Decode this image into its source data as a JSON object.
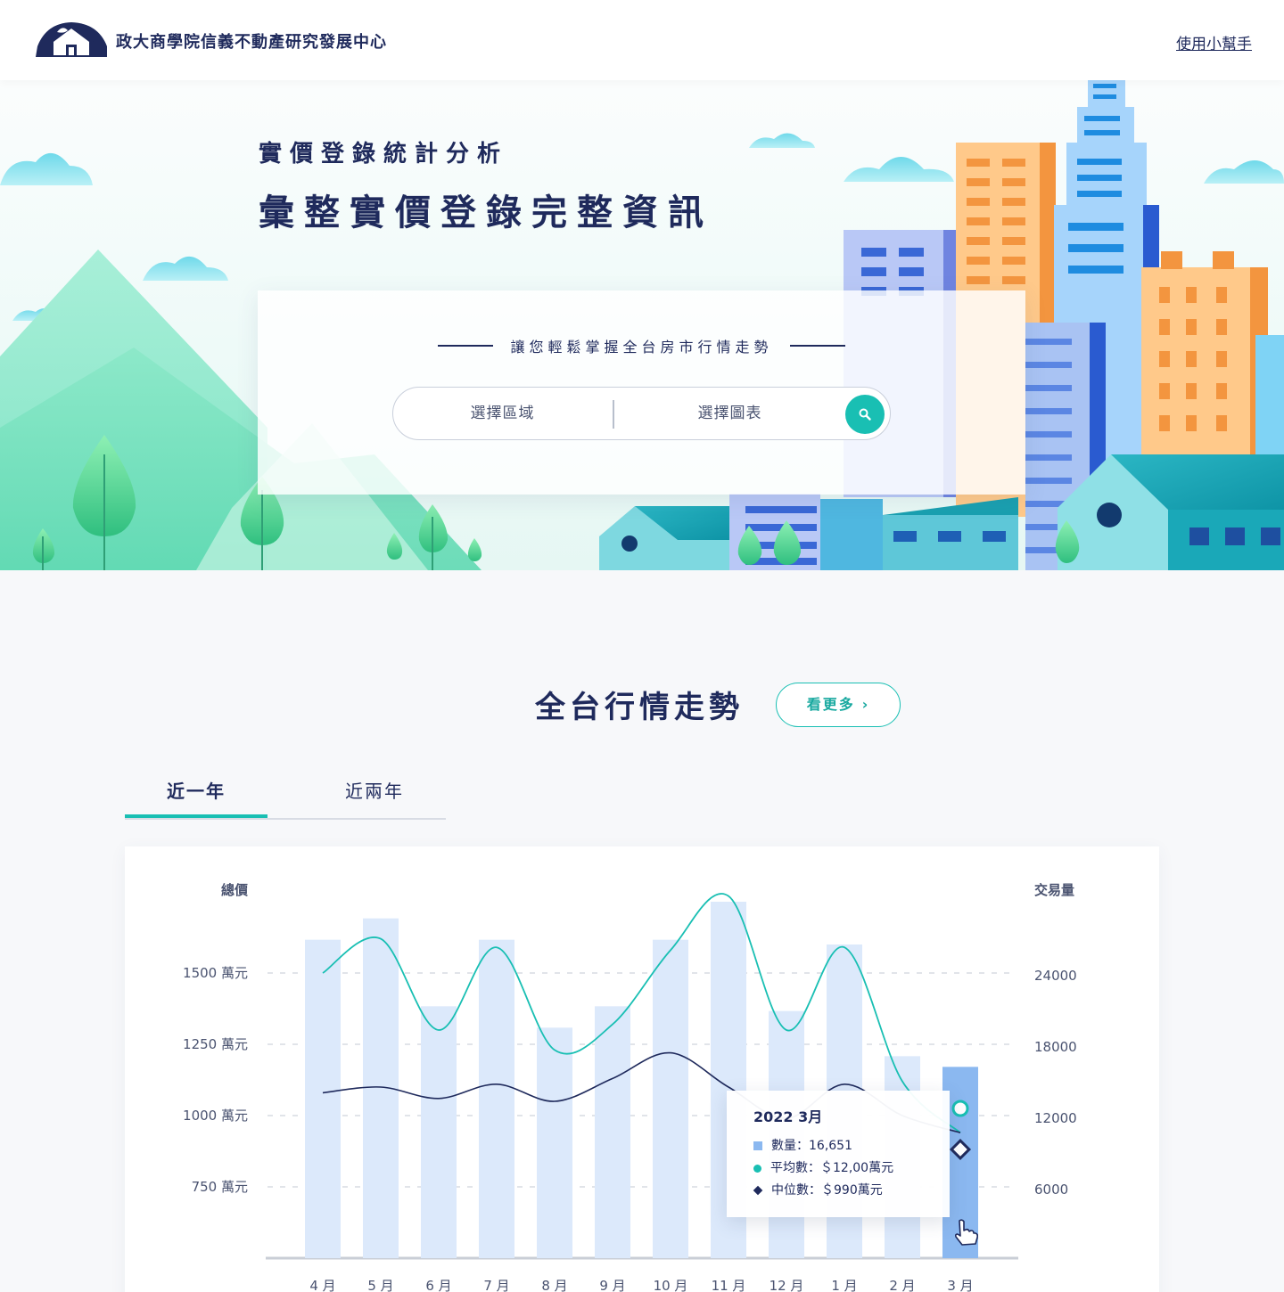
{
  "header": {
    "org_name": "政大商學院信義不動產研究發展中心",
    "help_link": "使用小幫手"
  },
  "hero": {
    "subtitle": "實價登錄統計分析",
    "title": "彙整實價登錄完整資訊",
    "tagline": "讓您輕鬆掌握全台房市行情走勢",
    "search": {
      "region_placeholder": "選擇區域",
      "chart_placeholder": "選擇圖表",
      "search_icon": "search-icon"
    }
  },
  "section": {
    "title": "全台行情走勢",
    "more_button": "看更多",
    "tabs": [
      "近一年",
      "近兩年"
    ],
    "active_tab": 0
  },
  "colors": {
    "navy": "#1f2a5c",
    "teal": "#19bfb3",
    "bar": "#dce9fb",
    "bar_highlight": "#8bb8f0"
  },
  "chart_data": {
    "type": "bar",
    "ylabel_left": "總價",
    "ylabel_right": "交易量",
    "left_ticks": [
      "1500 萬元",
      "1250 萬元",
      "1000 萬元",
      "750 萬元"
    ],
    "right_ticks": [
      "24000",
      "18000",
      "12000",
      "6000"
    ],
    "right_ylim": [
      0,
      24000
    ],
    "categories": [
      "4 月",
      "5 月",
      "6 月",
      "7 月",
      "8 月",
      "9 月",
      "10 月",
      "11 月",
      "12 月",
      "1 月",
      "2 月",
      "3 月"
    ],
    "series": [
      {
        "kind": "bar",
        "values": [
          26800,
          28600,
          21200,
          26800,
          19400,
          21200,
          26800,
          30000,
          20800,
          26400,
          17000,
          16100
        ]
      },
      {
        "kind": "line",
        "values": [
          1500,
          1620,
          1300,
          1590,
          1230,
          1320,
          1580,
          1770,
          1300,
          1590,
          1120,
          940
        ]
      },
      {
        "kind": "line",
        "values": [
          1080,
          1100,
          1060,
          1110,
          1050,
          1130,
          1220,
          1100,
          990,
          1110,
          1000,
          940
        ]
      }
    ],
    "tooltip": {
      "title": "2022 3月",
      "rows": [
        {
          "marker": "square",
          "label": "數量：16,651"
        },
        {
          "marker": "circle",
          "label": "平均數：＄12,00萬元"
        },
        {
          "marker": "diamond",
          "label": "中位數：＄990萬元"
        }
      ]
    }
  }
}
